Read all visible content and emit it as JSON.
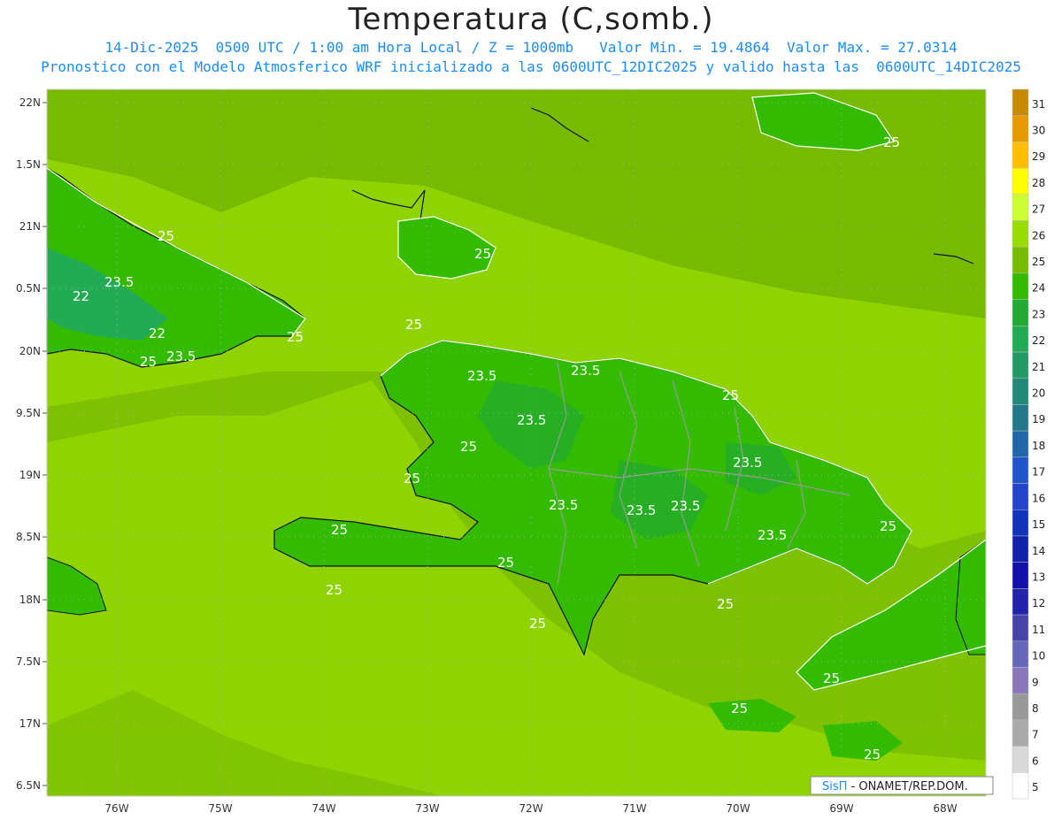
{
  "title": "Temperatura (C,somb.)",
  "subtitle_line1": "14-Dic-2025  0500 UTC / 1:00 am Hora Local / Z = 1000mb   Valor Min. = 19.4864  Valor Max. = 27.0314",
  "subtitle_line2": "Pronostico con el Modelo Atmosferico WRF inicializado a las 0600UTC_12DIC2025 y valido hasta las  0600UTC_14DIC2025",
  "lat_labels": [
    "22N",
    "1.5N",
    "21N",
    "0.5N",
    "20N",
    "9.5N",
    "19N",
    "8.5N",
    "18N",
    "7.5N",
    "17N",
    "6.5N"
  ],
  "lon_labels": [
    "76W",
    "75W",
    "74W",
    "73W",
    "72W",
    "71W",
    "70W",
    "69W",
    "68W"
  ],
  "contour_labels": [
    "25",
    "23.5",
    "22"
  ],
  "colorbar": {
    "labels": [
      "31",
      "30",
      "29",
      "28",
      "27",
      "26",
      "25",
      "24",
      "23",
      "22",
      "21",
      "20",
      "19",
      "18",
      "17",
      "16",
      "15",
      "14",
      "13",
      "12",
      "11",
      "10",
      "9",
      "8",
      "7",
      "6",
      "5"
    ],
    "colors": [
      "#c88a00",
      "#e69a00",
      "#ffbf00",
      "#ffff00",
      "#ccff33",
      "#99dd00",
      "#77bb00",
      "#33bb00",
      "#22aa33",
      "#22aa55",
      "#229966",
      "#228877",
      "#227788",
      "#2266aa",
      "#2255cc",
      "#2244cc",
      "#1133bb",
      "#1122aa",
      "#1111aa",
      "#2222aa",
      "#4444aa",
      "#6666bb",
      "#8877bb",
      "#999999",
      "#aaaaaa",
      "#d8d8d8",
      "#ffffff"
    ]
  },
  "credit": {
    "brand": "SisΠ",
    "text": " - ONAMET/REP.DOM."
  }
}
